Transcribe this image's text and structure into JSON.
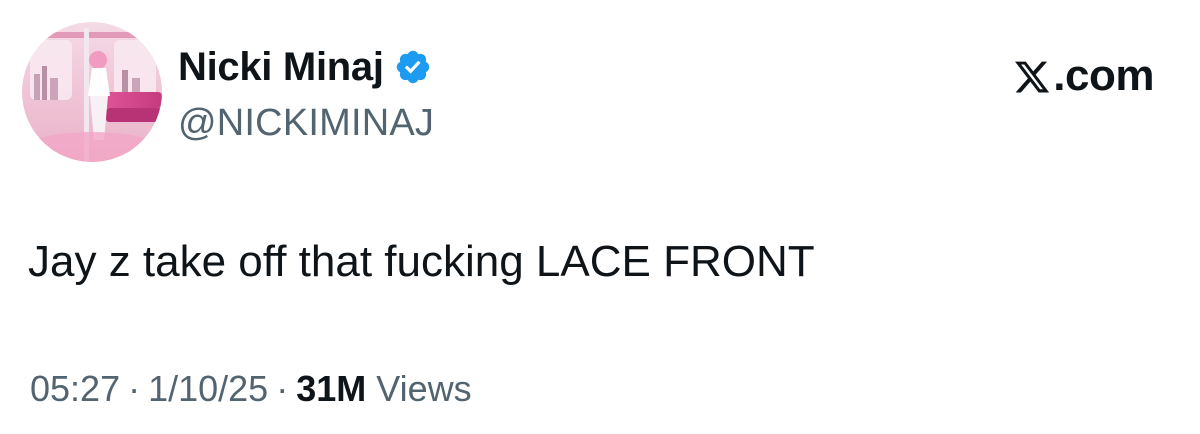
{
  "author": {
    "display_name": "Nicki Minaj",
    "handle": "@NICKIMINAJ",
    "verified_color": "#1d9bf0"
  },
  "brand": {
    "label": ".com",
    "icon": "x-logo-icon"
  },
  "tweet": {
    "text": "Jay z take off that fucking LACE FRONT"
  },
  "meta": {
    "time": "05:27",
    "separator": "·",
    "date": "1/10/25",
    "views_count": "31M",
    "views_label": "Views"
  },
  "colors": {
    "text_primary": "#0f1419",
    "text_secondary": "#536471",
    "verified": "#1d9bf0"
  }
}
